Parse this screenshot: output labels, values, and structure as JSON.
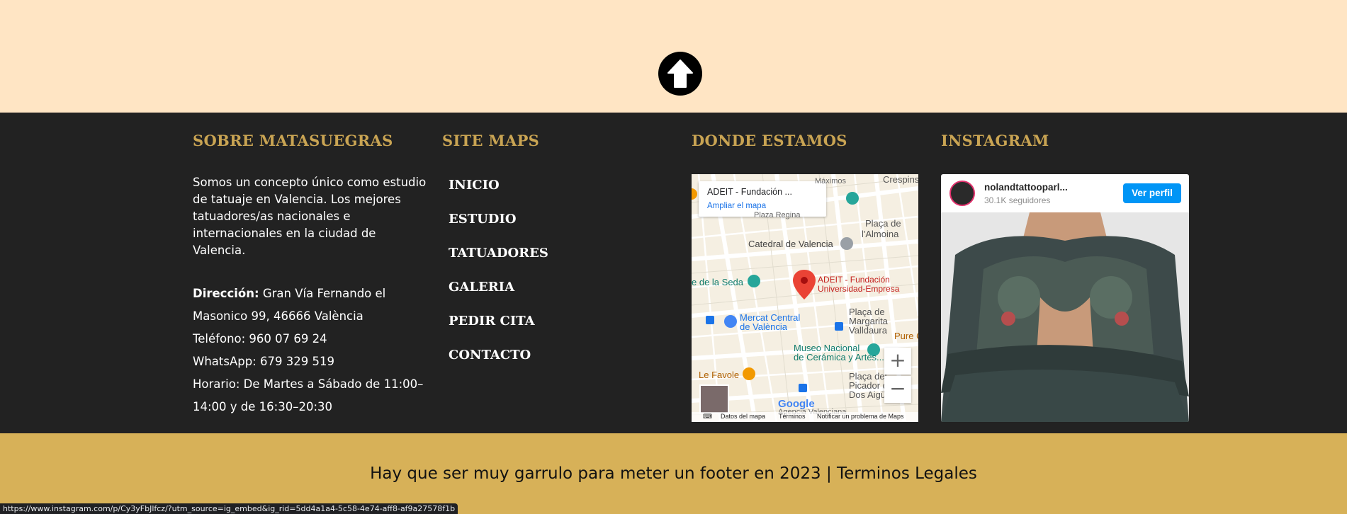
{
  "scroll_top": {
    "icon": "arrow-up-icon"
  },
  "footer": {
    "about": {
      "heading": "SOBRE MATASUEGRAS",
      "text": "Somos un concepto único como estudio de tatuaje en Valencia. Los mejores tatuadores/as nacionales e internacionales en la ciudad de Valencia.",
      "address_label": "Dirección:",
      "address_value": "Gran Vía Fernando el Masonico 99, 46666 València",
      "phone": "Teléfono: 960 07 69 24",
      "whatsapp": "WhatsApp: 679 329 519",
      "hours": "Horario: De Martes a Sábado de 11:00–14:00 y de 16:30–20:30"
    },
    "sitemap": {
      "heading": "SITE MAPS",
      "links": [
        "INICIO",
        "ESTUDIO",
        "TATUADORES",
        "GALERIA",
        "PEDIR CITA",
        "CONTACTO"
      ]
    },
    "location": {
      "heading": "DONDE ESTAMOS",
      "card_title": "ADEIT - Fundación ...",
      "card_link": "Ampliar el mapa",
      "pin_label_1": "ADEIT - Fundación",
      "pin_label_2": "Universidad-Empresa",
      "places": {
        "crespins": "Crespins",
        "maximos": "Máximos",
        "placa_nap": "Plaça de",
        "lalmoina": "l'Almoina",
        "regina": "Plaza Regina",
        "catedral": "Catedral de Valencia",
        "seda": "e de la Seda",
        "mercat_1": "Mercat Central",
        "mercat_2": "de València",
        "margarita_1": "Plaça de",
        "margarita_2": "Margarita",
        "margarita_3": "Valldaura",
        "pure": "Pure C",
        "museo_1": "Museo Nacional",
        "museo_2": "de Cerámica y Artes...",
        "favole": "Le Favole",
        "picador_1": "Plaça del",
        "picador_2": "Picador de",
        "picador_3": "Dos Aigües",
        "agencia": "Agencia Valenciana",
        "google": "Google"
      },
      "footer_links": {
        "data": "Datos del mapa",
        "terms": "Términos",
        "report": "Notificar un problema de Maps"
      },
      "zoom_in": "+",
      "zoom_out": "−"
    },
    "instagram": {
      "heading": "INSTAGRAM",
      "username": "nolandtattooparl...",
      "followers": "30.1K seguidores",
      "button": "Ver perfil"
    }
  },
  "legal": {
    "text": "Hay que ser muy garrulo para meter un footer en 2023 | ",
    "link": "Terminos Legales"
  },
  "status_url": "https://www.instagram.com/p/Cy3yFbJlfcz/?utm_source=ig_embed&ig_rid=5dd4a1a4-5c58-4e74-aff8-af9a27578f1b",
  "colors": {
    "top_band": "#FFE5C4",
    "footer_bg": "#222222",
    "heading": "#C9A453",
    "bottom_bar": "#D7B158",
    "ig_button": "#0095F6"
  }
}
